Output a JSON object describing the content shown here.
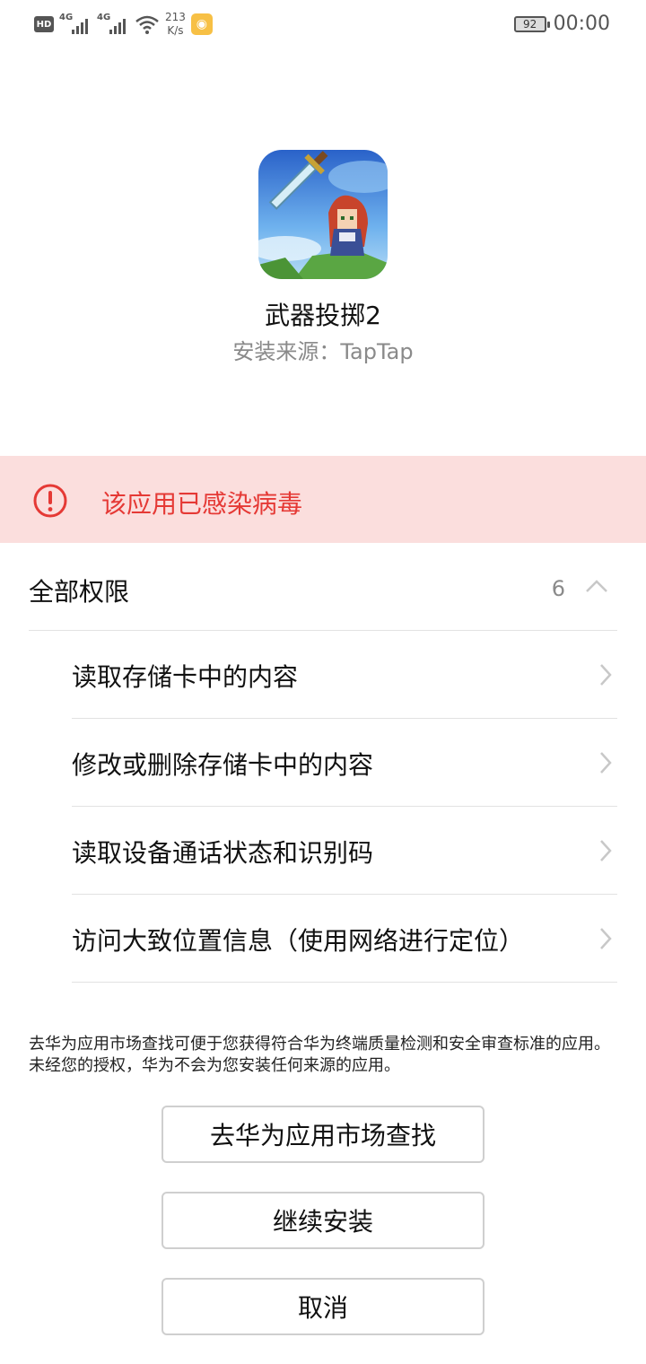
{
  "status_bar": {
    "hd_label": "HD",
    "network_1": "4G",
    "network_2": "4G",
    "speed_value": "213",
    "speed_unit": "K/s",
    "battery": "92",
    "time": "00:00"
  },
  "app": {
    "name": "武器投掷2",
    "source": "安装来源：TapTap"
  },
  "warning": {
    "text": "该应用已感染病毒",
    "color": "#e53935",
    "background": "#fbdedd"
  },
  "permissions": {
    "title": "全部权限",
    "count": "6",
    "items": [
      {
        "label": "读取存储卡中的内容"
      },
      {
        "label": "修改或删除存储卡中的内容"
      },
      {
        "label": "读取设备通话状态和识别码"
      },
      {
        "label": "访问大致位置信息（使用网络进行定位）"
      }
    ]
  },
  "notice": "去华为应用市场查找可便于您获得符合华为终端质量检测和安全审查标准的应用。未经您的授权，华为不会为您安装任何来源的应用。",
  "buttons": {
    "market": "去华为应用市场查找",
    "continue": "继续安装",
    "cancel": "取消"
  }
}
